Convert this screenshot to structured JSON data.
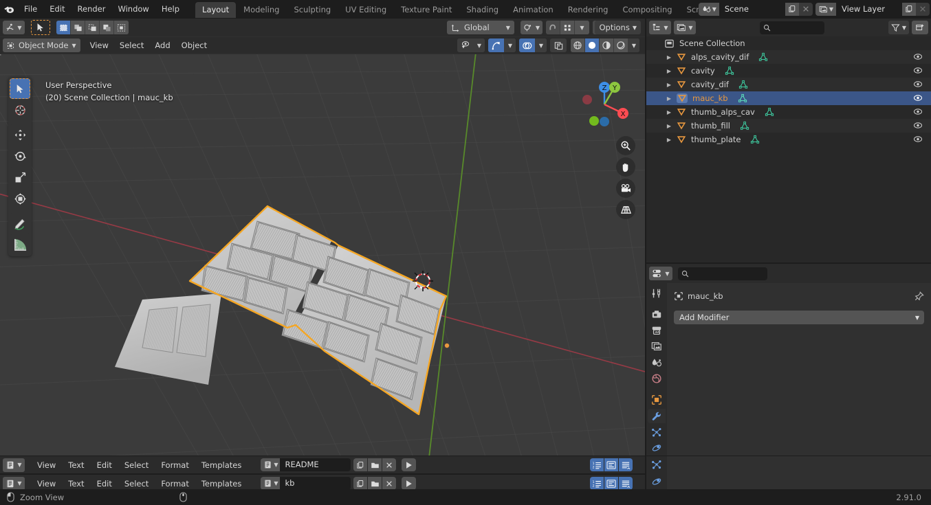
{
  "app": {
    "name": "Blender",
    "version": "2.91.0"
  },
  "topbar": {
    "logo_icon": "blender-logo-icon",
    "menus": [
      "File",
      "Edit",
      "Render",
      "Window",
      "Help"
    ],
    "workspace_tabs": [
      {
        "label": "Layout",
        "active": true
      },
      {
        "label": "Modeling",
        "active": false
      },
      {
        "label": "Sculpting",
        "active": false
      },
      {
        "label": "UV Editing",
        "active": false
      },
      {
        "label": "Texture Paint",
        "active": false
      },
      {
        "label": "Shading",
        "active": false
      },
      {
        "label": "Animation",
        "active": false
      },
      {
        "label": "Rendering",
        "active": false
      },
      {
        "label": "Compositing",
        "active": false
      },
      {
        "label": "Scripting",
        "active": false
      }
    ],
    "scene": {
      "icon": "scene-icon",
      "name": "Scene",
      "new_icon": "duplicate-icon",
      "remove_icon": "close-icon"
    },
    "view_layer": {
      "icon": "view-layer-icon",
      "name": "View Layer",
      "new_icon": "duplicate-icon",
      "remove_icon": "close-icon"
    }
  },
  "viewport": {
    "tool_header": {
      "editor_type_icon": "editor-type-icon",
      "active_tool_icon": "select-box-tool-icon",
      "select_modes": [
        "set",
        "extend",
        "subtract",
        "invert",
        "intersect"
      ],
      "transform_orientation": "Global",
      "orientation_icon": "orientation-icon",
      "snap_icon": "snap-magnet-icon",
      "snap_target_icon": "snap-target-icon",
      "proportional_icon": "proportional-edit-icon",
      "falloff_icon": "falloff-curve-icon",
      "options_label": "Options"
    },
    "header": {
      "mode": "Object Mode",
      "mode_icon": "object-mode-icon",
      "menus": [
        "View",
        "Select",
        "Add",
        "Object"
      ],
      "visibility_icon": "visibility-eye-icon",
      "gizmo_icon": "gizmo-icon",
      "overlays_icon": "overlays-icon",
      "xray_icon": "xray-toggle-icon",
      "shading_modes": [
        "wireframe",
        "solid",
        "material-preview",
        "rendered"
      ],
      "shading_active": "solid"
    },
    "overlay_text": {
      "line1": "User Perspective",
      "line2": "(20) Scene Collection | mauc_kb"
    },
    "toolbar_tools": [
      {
        "name": "tweak-select-tool",
        "active": true
      },
      {
        "name": "cursor-tool",
        "active": false
      },
      {
        "name": "move-tool",
        "active": false
      },
      {
        "name": "rotate-tool",
        "active": false
      },
      {
        "name": "scale-tool",
        "active": false
      },
      {
        "name": "transform-tool",
        "active": false
      },
      {
        "name": "annotate-tool",
        "active": false
      },
      {
        "name": "measure-tool",
        "active": false
      }
    ],
    "nav_gizmo": {
      "axis_labels": [
        "Z",
        "Y",
        "X"
      ],
      "colors": {
        "x": "#fc4c52",
        "y": "#8dc63f",
        "z": "#3d8ee6"
      }
    },
    "nav_buttons": [
      "zoom-icon",
      "pan-hand-icon",
      "camera-view-icon",
      "ortho-persp-icon"
    ],
    "selection_outline_color": "#f5a623",
    "scene_objects_visible": "keyboard plate mesh (selected) and a smaller flat plate"
  },
  "outliner": {
    "display_mode_icon": "outliner-display-mode-icon",
    "filter_id_icon": "filter-id-icon",
    "search_placeholder": "",
    "search_icon": "search-icon",
    "filter_icon": "filter-funnel-icon",
    "new_collection_icon": "new-collection-icon",
    "root": {
      "label": "Scene Collection",
      "icon": "scene-collection-icon"
    },
    "items": [
      {
        "label": "alps_cavity_dif",
        "object_icon": "mesh-object-icon",
        "data_icon": "mesh-data-icon",
        "selected": false,
        "visible": true
      },
      {
        "label": "cavity",
        "object_icon": "mesh-object-icon",
        "data_icon": "mesh-data-icon",
        "selected": false,
        "visible": true
      },
      {
        "label": "cavity_dif",
        "object_icon": "mesh-object-icon",
        "data_icon": "mesh-data-icon",
        "selected": false,
        "visible": true
      },
      {
        "label": "mauc_kb",
        "object_icon": "mesh-object-icon",
        "data_icon": "mesh-data-icon",
        "selected": true,
        "visible": true
      },
      {
        "label": "thumb_alps_cav",
        "object_icon": "mesh-object-icon",
        "data_icon": "mesh-data-icon",
        "selected": false,
        "visible": true
      },
      {
        "label": "thumb_fill",
        "object_icon": "mesh-object-icon",
        "data_icon": "mesh-data-icon",
        "selected": false,
        "visible": true
      },
      {
        "label": "thumb_plate",
        "object_icon": "mesh-object-icon",
        "data_icon": "mesh-data-icon",
        "selected": false,
        "visible": true
      }
    ],
    "row_selected_color": "#3b5688",
    "object_icon_color": "#e8983f",
    "data_icon_color": "#3ecfa3"
  },
  "properties": {
    "editor_type_icon": "properties-editor-icon",
    "search_icon": "search-icon",
    "search_placeholder": "",
    "tabs": [
      {
        "name": "tool-tab",
        "active": false
      },
      {
        "name": "render-tab",
        "active": false
      },
      {
        "name": "output-tab",
        "active": false
      },
      {
        "name": "view-layer-tab",
        "active": false
      },
      {
        "name": "scene-tab",
        "active": false
      },
      {
        "name": "world-tab",
        "active": false
      },
      {
        "name": "object-tab",
        "active": false
      },
      {
        "name": "modifier-tab",
        "active": true
      },
      {
        "name": "particles-tab",
        "active": false
      },
      {
        "name": "physics-tab",
        "active": false
      }
    ],
    "breadcrumb": {
      "object_icon": "object-icon",
      "object_name": "mauc_kb",
      "pin_icon": "pin-icon"
    },
    "add_modifier_label": "Add Modifier",
    "add_modifier_chevron": "chevron-down-icon"
  },
  "text_editors": [
    {
      "editor_type_icon": "text-editor-icon",
      "menus": [
        "View",
        "Text",
        "Edit",
        "Select",
        "Format",
        "Templates"
      ],
      "datablock_icon": "text-datablock-icon",
      "filename": "README",
      "new_icon": "new-text-icon",
      "open_icon": "open-folder-icon",
      "unlink_icon": "close-icon",
      "run_icon": "run-script-icon",
      "right_toggles": [
        "line-numbers-icon",
        "word-wrap-icon",
        "syntax-highlight-icon"
      ]
    },
    {
      "editor_type_icon": "text-editor-icon",
      "menus": [
        "View",
        "Text",
        "Edit",
        "Select",
        "Format",
        "Templates"
      ],
      "datablock_icon": "text-datablock-icon",
      "filename": "kb",
      "new_icon": "new-text-icon",
      "open_icon": "open-folder-icon",
      "unlink_icon": "close-icon",
      "run_icon": "run-script-icon",
      "right_toggles": [
        "line-numbers-icon",
        "word-wrap-icon",
        "syntax-highlight-icon"
      ]
    }
  ],
  "statusbar": {
    "mouse_icon": "mouse-left-icon",
    "hint": "Zoom View",
    "secondary_mouse_icon": "mouse-middle-icon",
    "version": "2.91.0"
  }
}
